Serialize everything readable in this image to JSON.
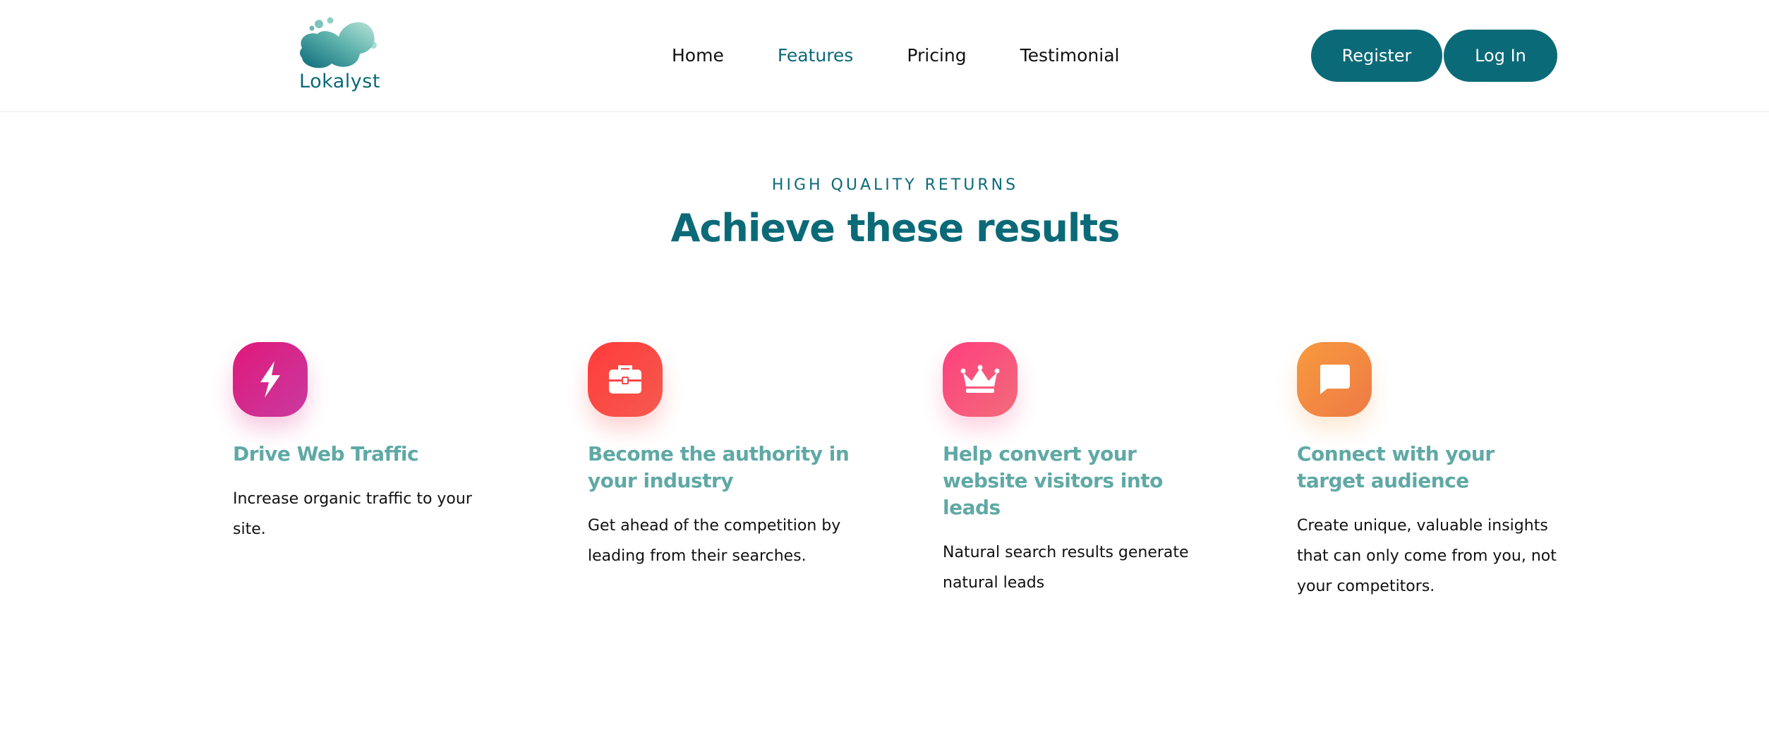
{
  "brand": {
    "name": "Lokalyst",
    "logo_icon": "blob-logo-icon",
    "color": "#0b6a78"
  },
  "nav": {
    "items": [
      {
        "label": "Home",
        "active": false
      },
      {
        "label": "Features",
        "active": true
      },
      {
        "label": "Pricing",
        "active": false
      },
      {
        "label": "Testimonial",
        "active": false
      }
    ]
  },
  "auth": {
    "register_label": "Register",
    "login_label": "Log In"
  },
  "section": {
    "eyebrow": "HIGH QUALITY RETURNS",
    "title": "Achieve these results"
  },
  "features": [
    {
      "icon": "lightning-icon",
      "gradient": [
        "#e0187a",
        "#c93aa0"
      ],
      "title": "Drive Web Traffic",
      "description": "Increase organic traffic to your site."
    },
    {
      "icon": "briefcase-icon",
      "gradient": [
        "#ff3b3b",
        "#f55a4e"
      ],
      "title": "Become the authority in your industry",
      "description": "Get ahead of the competition by leading from their searches."
    },
    {
      "icon": "crown-icon",
      "gradient": [
        "#ff3f7e",
        "#f26b7a"
      ],
      "title": "Help convert your website visitors into leads",
      "description": "Natural search results generate natural leads"
    },
    {
      "icon": "chat-bubble-icon",
      "gradient": [
        "#f79a3e",
        "#ee7a45"
      ],
      "title": "Connect with your target audience",
      "description": "Create unique, valuable insights that can only come from you, not your competitors."
    }
  ]
}
